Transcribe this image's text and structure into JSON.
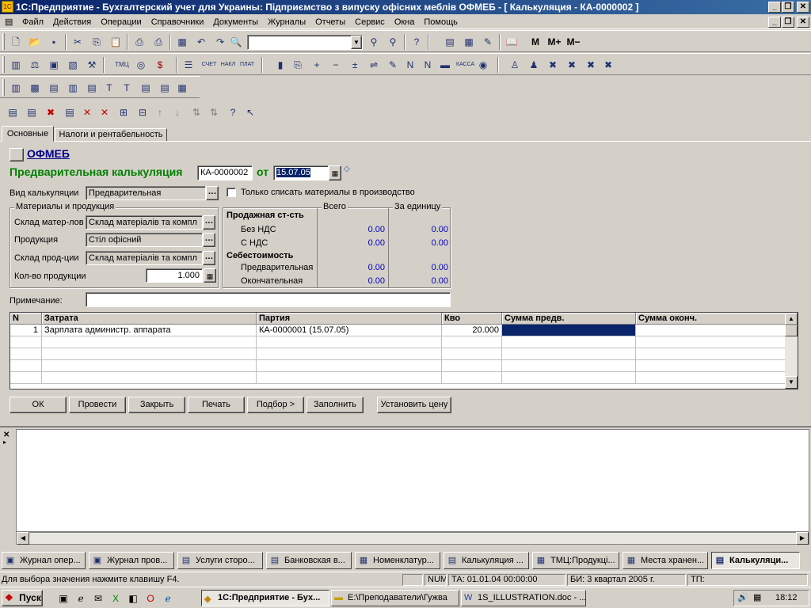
{
  "window": {
    "title": "1С:Предприятие - Бухгалтерский учет для Украины: Підприємство з випуску офісних меблів ОФМЕБ - [ Калькуляция - КА-0000002 ]",
    "min": "_",
    "restore": "❐",
    "close": "✕"
  },
  "menu": [
    "Файл",
    "Действия",
    "Операции",
    "Справочники",
    "Документы",
    "Журналы",
    "Отчеты",
    "Сервис",
    "Окна",
    "Помощь"
  ],
  "toolbar_text": {
    "m": "M",
    "mplus": "M+",
    "mminus": "M−"
  },
  "tabs": [
    "Основные",
    "Налоги и рентабельность"
  ],
  "form": {
    "org_link": "ОФМЕБ",
    "doc_title": "Предварительная калькуляция",
    "doc_number": "КА-0000002",
    "from_label": "от",
    "doc_date": "15.07.05",
    "calc_type_label": "Вид калькуляции",
    "calc_type_value": "Предварительная",
    "only_write_off_label": "Только списать материалы в производство",
    "only_write_off_checked": false,
    "materials_group": "Материалы и продукция",
    "warehouse_mat_label": "Склад матер-лов",
    "warehouse_mat_value": "Склад матеріалів та компл",
    "product_label": "Продукция",
    "product_value": "Стіл офісний",
    "warehouse_prod_label": "Склад прод-ции",
    "warehouse_prod_value": "Склад матеріалів та компл",
    "qty_label": "Кол-во продукции",
    "qty_value": "1.000",
    "totals": {
      "col_total": "Всего",
      "col_per_unit": "За единицу",
      "sale_heading": "Продажная ст-сть",
      "without_vat": "Без НДС",
      "with_vat": "С НДС",
      "cost_heading": "Себестоимость",
      "preliminary": "Предварительная",
      "final": "Окончательная",
      "without_vat_total": "0.00",
      "without_vat_unit": "0.00",
      "with_vat_total": "0.00",
      "with_vat_unit": "0.00",
      "preliminary_total": "0.00",
      "preliminary_unit": "0.00",
      "final_total": "0.00",
      "final_unit": "0.00"
    },
    "note_label": "Примечание:",
    "note_value": ""
  },
  "grid": {
    "headers": [
      "N",
      "Затрата",
      "Партия",
      "Кво",
      "Сумма предв.",
      "Сумма оконч."
    ],
    "rows": [
      [
        "1",
        "Зарплата администр. аппарата",
        "КА-0000001 (15.07.05)",
        "20.000",
        "",
        ""
      ]
    ]
  },
  "buttons": {
    "ok": "ОК",
    "post": "Провести",
    "close": "Закрыть",
    "print": "Печать",
    "select": "Подбор >",
    "fill": "Заполнить",
    "set_price": "Установить цену"
  },
  "tasks": [
    "Журнал опер...",
    "Журнал пров...",
    "Услуги сторо...",
    "Банковская в...",
    "Номенклатур...",
    "Калькуляция ...",
    "ТМЦ:Продукці...",
    "Места хранен...",
    "Калькуляци..."
  ],
  "status": {
    "hint": "Для выбора значения нажмите клавишу F4.",
    "num": "NUM",
    "ta": "ТА: 01.01.04  00:00:00",
    "bi": "БИ: 3 квартал 2005 г.",
    "tp": "ТП:"
  },
  "taskbar": {
    "start": "Пуск",
    "items": [
      "1С:Предприятие - Бух...",
      "E:\\Преподаватели\\Гужва",
      "1S_ILLUSTRATION.doc - ..."
    ],
    "clock": "18:12"
  }
}
